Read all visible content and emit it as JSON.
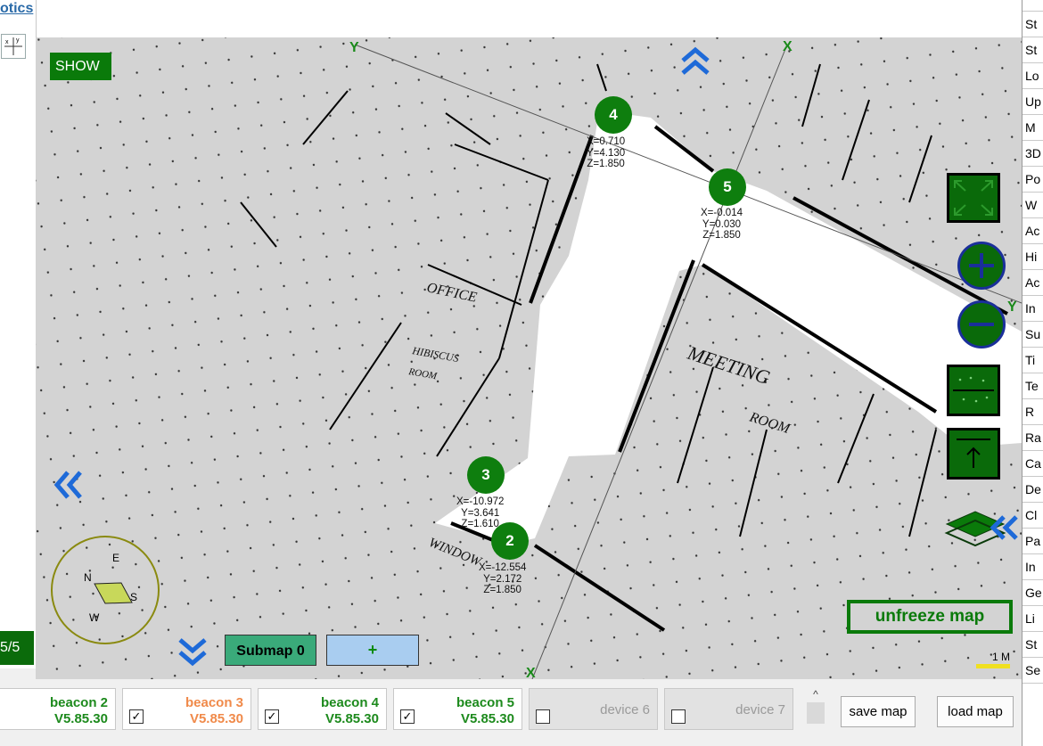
{
  "left": {
    "options_link": "otics",
    "page_indicator": "5/5"
  },
  "map": {
    "show_label": "SHOW",
    "axis": {
      "y_top": "Y",
      "x_top": "X",
      "y_right": "Y",
      "x_bottom": "X"
    },
    "room_labels": [
      "OFFICE",
      "HIBISCUS",
      "ROOM",
      "MEETING",
      "ROOM",
      "WINDOW"
    ],
    "beacons": [
      {
        "id": "4",
        "x": "X=0.710",
        "y": "Y=4.130",
        "z": "Z=1.850"
      },
      {
        "id": "5",
        "x": "X=-0.014",
        "y": "Y=0.030",
        "z": "Z=1.850"
      },
      {
        "id": "3",
        "x": "X=-10.972",
        "y": "Y=3.641",
        "z": "Z=1.610"
      },
      {
        "id": "2",
        "x": "X=-12.554",
        "y": "Y=2.172",
        "z": "Z=1.850"
      }
    ],
    "compass": {
      "n": "N",
      "e": "E",
      "s": "S",
      "w": "W"
    },
    "submap_label": "Submap 0",
    "add_submap_label": "+",
    "unfreeze_label": "unfreeze map",
    "scale_label": "1 M"
  },
  "right_list": [
    "St",
    "St",
    "Lo",
    "Up",
    "M",
    "3D",
    "Po",
    "W",
    "Ac",
    "Hi",
    "Ac",
    "In",
    "Su",
    "Ti",
    "Te",
    "R",
    "Ra",
    "Ca",
    "De",
    "Cl",
    "Pa",
    "In",
    "Ge",
    "Li",
    "St",
    "Se"
  ],
  "devices": [
    {
      "name": "beacon 2",
      "version": "V5.85.30",
      "checked": "✓",
      "state": "ok"
    },
    {
      "name": "beacon 3",
      "version": "V5.85.30",
      "checked": "✓",
      "state": "warn"
    },
    {
      "name": "beacon 4",
      "version": "V5.85.30",
      "checked": "✓",
      "state": "ok"
    },
    {
      "name": "beacon 5",
      "version": "V5.85.30",
      "checked": "✓",
      "state": "ok"
    },
    {
      "name": "device 6",
      "version": "",
      "checked": "",
      "state": "off"
    },
    {
      "name": "device 7",
      "version": "",
      "checked": "",
      "state": "off"
    }
  ],
  "buttons": {
    "save_map": "save map",
    "load_map": "load map"
  },
  "colors": {
    "beacon_green": "#0e7e0e",
    "warn_orange": "#f08a4a",
    "map_bg": "#d3d3d3"
  }
}
